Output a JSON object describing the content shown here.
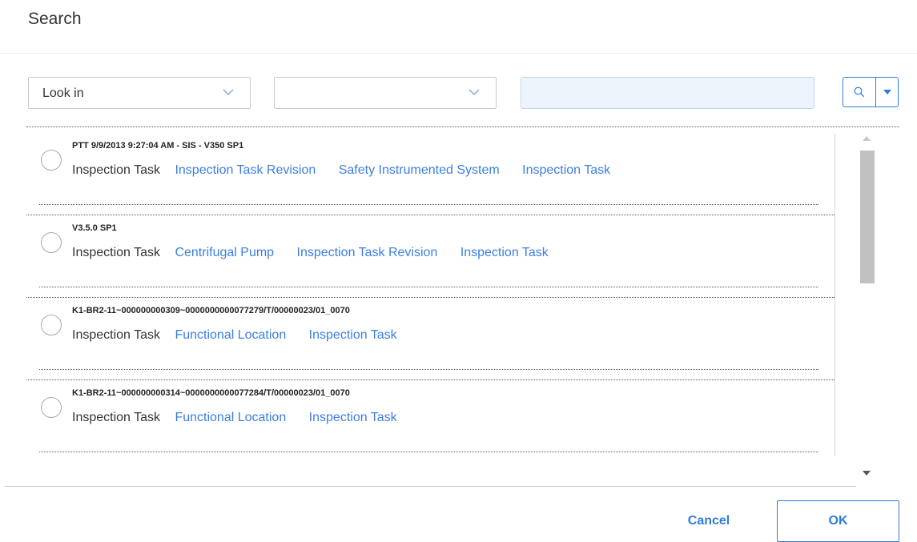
{
  "dialog": {
    "title": "Search"
  },
  "search_bar": {
    "look_in": {
      "value": "Look in",
      "icon": "chevron-down-icon"
    },
    "second_select": {
      "value": "",
      "icon": "chevron-down-icon"
    },
    "query": {
      "value": "",
      "placeholder": ""
    },
    "search_button": {
      "icon": "search-icon",
      "dropdown_icon": "caret-down-icon"
    }
  },
  "results": [
    {
      "heading": "PTT 9/9/2013 9:27:04 AM - SIS - V350 SP1",
      "family": "Inspection Task",
      "links": [
        "Inspection Task Revision",
        "Safety Instrumented System",
        "Inspection Task"
      ]
    },
    {
      "heading": "V3.5.0 SP1",
      "family": "Inspection Task",
      "links": [
        "Centrifugal Pump",
        "Inspection Task Revision",
        "Inspection Task"
      ]
    },
    {
      "heading": "K1-BR2-11~000000000309~0000000000077279/T/00000023/01_0070",
      "family": "Inspection Task",
      "links": [
        "Functional Location",
        "Inspection Task"
      ]
    },
    {
      "heading": "K1-BR2-11~000000000314~0000000000077284/T/00000023/01_0070",
      "family": "Inspection Task",
      "links": [
        "Functional Location",
        "Inspection Task"
      ]
    }
  ],
  "footer": {
    "cancel_label": "Cancel",
    "ok_label": "OK"
  },
  "colors": {
    "accent": "#2f7bd8",
    "link": "#3b7fe0",
    "input_bg": "#eef4fb"
  }
}
